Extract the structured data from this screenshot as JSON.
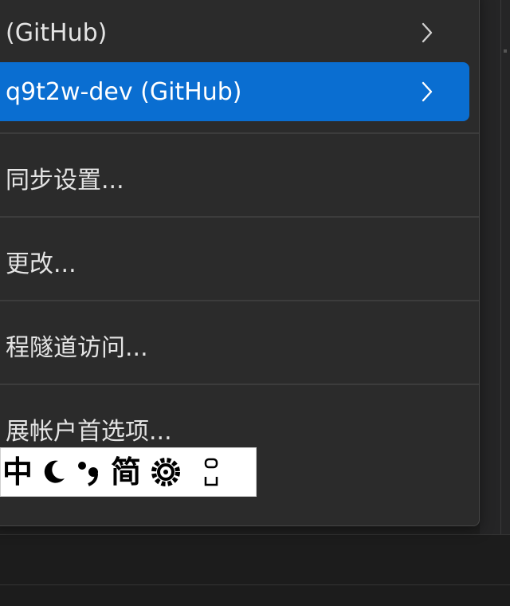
{
  "menu": {
    "items": [
      {
        "label": " (GitHub)",
        "has_submenu": true,
        "highlighted": false
      },
      {
        "label": "q9t2w-dev (GitHub)",
        "has_submenu": true,
        "highlighted": true
      },
      {
        "label": "同步设置...",
        "has_submenu": false,
        "highlighted": false
      },
      {
        "label": "更改...",
        "has_submenu": false,
        "highlighted": false
      },
      {
        "label": "程隧道访问...",
        "has_submenu": false,
        "highlighted": false
      },
      {
        "label": "展帐户首选项...",
        "has_submenu": false,
        "highlighted": false
      }
    ],
    "highlight_color": "#0a6ed1",
    "background_color": "#2b2b2b"
  },
  "ime_toolbar": {
    "mode_label": "中",
    "simplified_label": "简",
    "icons": [
      "moon-icon",
      "punctuation-icon",
      "gear-icon",
      "more-icon"
    ]
  }
}
